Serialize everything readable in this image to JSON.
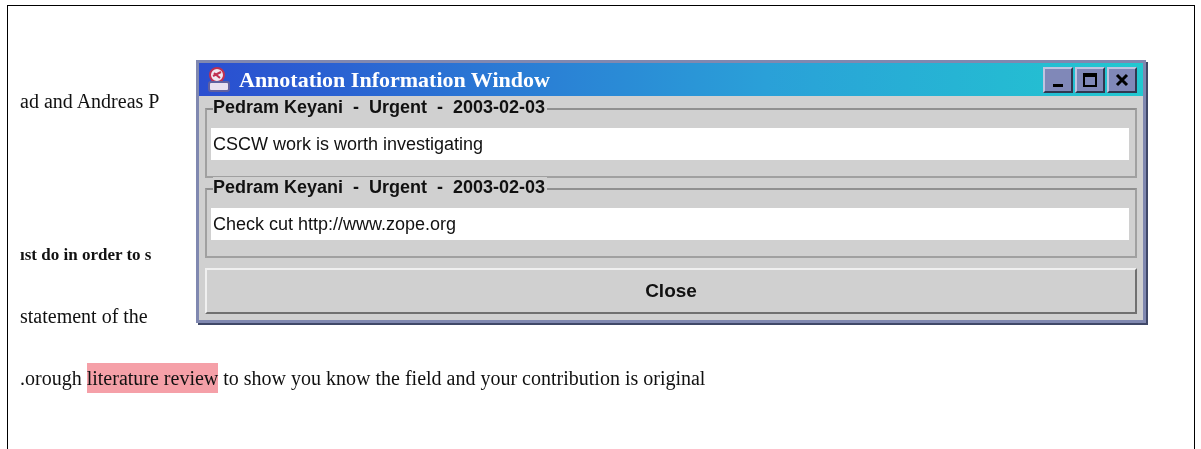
{
  "document": {
    "lines": [
      {
        "bold": false,
        "segments": [
          {
            "text": "ad and Andreas P",
            "highlighted": false
          }
        ]
      },
      {
        "bold": true,
        "segments": [
          {
            "text": "ıst do in order to s",
            "highlighted": false
          }
        ]
      },
      {
        "bold": false,
        "segments": [
          {
            "text": "statement of the",
            "highlighted": false
          }
        ]
      },
      {
        "bold": false,
        "segments": [
          {
            "text": ".orough ",
            "highlighted": false
          },
          {
            "text": "literature review",
            "highlighted": true
          },
          {
            "text": " to show you know the field and your contribution is original",
            "highlighted": false
          }
        ]
      }
    ]
  },
  "dialog": {
    "title": "Annotation Information Window",
    "annotations": [
      {
        "header": "Pedram Keyani  -  Urgent  -  2003-02-03",
        "body": "CSCW work is worth investigating"
      },
      {
        "header": "Pedram Keyani  -  Urgent  -  2003-02-03",
        "body": "Check cut http://www.zope.org"
      }
    ],
    "close_button": "Close"
  }
}
